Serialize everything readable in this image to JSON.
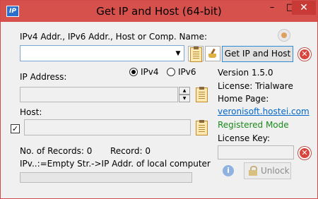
{
  "window": {
    "title": "Get IP and Host (64-bit)",
    "icon_text": "IP",
    "minimize": "–",
    "maximize": "□",
    "close": "✕"
  },
  "input": {
    "label": "IPv4 Addr., IPv6 Addr., Host or Comp. Name:",
    "value": "",
    "get_button": "Get IP and Host"
  },
  "ip": {
    "label": "IP Address:",
    "ipv4_label": "IPv4",
    "ipv6_label": "IPv6",
    "selected": "IPv4",
    "value": ""
  },
  "host": {
    "label": "Host:",
    "checked": true,
    "value": ""
  },
  "stats": {
    "records_label": "No. of Records: 0",
    "record_label": "Record: 0",
    "hint": "IPv..:=Empty Str.->IP Addr. of local computer",
    "progress": 0
  },
  "info": {
    "version": "Version 1.5.0",
    "license": "License: Trialware",
    "homepage_label": "Home Page:",
    "homepage_link": "veronisoft.hostei.com",
    "mode": "Registered Mode",
    "license_key_label": "License Key:",
    "license_key_value": "",
    "unlock_button": "Unlock"
  },
  "colors": {
    "titlebar": "#d6504c",
    "close_button": "#c73a35",
    "link": "#0066cc",
    "registered": "#1a8a1a"
  }
}
